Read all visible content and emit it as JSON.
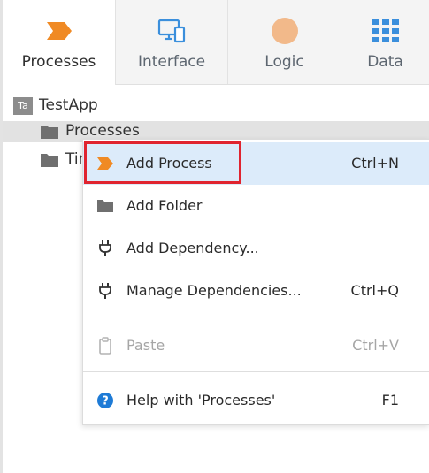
{
  "tabs": [
    {
      "label": "Processes",
      "icon": "process-icon"
    },
    {
      "label": "Interface",
      "icon": "interface-icon"
    },
    {
      "label": "Logic",
      "icon": "logic-icon"
    },
    {
      "label": "Data",
      "icon": "data-grid-icon"
    }
  ],
  "tree": {
    "app_badge": "Ta",
    "app_name": "TestApp",
    "items": [
      {
        "label": "Processes"
      },
      {
        "label": "Tim"
      }
    ]
  },
  "menu": {
    "items": [
      {
        "label": "Add Process",
        "shortcut": "Ctrl+N",
        "icon": "process-icon"
      },
      {
        "label": "Add Folder",
        "shortcut": "",
        "icon": "folder-icon"
      },
      {
        "label": "Add Dependency...",
        "shortcut": "",
        "icon": "plug-icon"
      },
      {
        "label": "Manage Dependencies...",
        "shortcut": "Ctrl+Q",
        "icon": "plug-icon"
      },
      {
        "label": "Paste",
        "shortcut": "Ctrl+V",
        "icon": "clipboard-icon",
        "disabled": true
      },
      {
        "label": "Help with 'Processes'",
        "shortcut": "F1",
        "icon": "help-icon"
      }
    ]
  },
  "colors": {
    "accent_orange": "#f08a24",
    "highlight": "#dcebfa",
    "red_outline": "#e0242f",
    "icon_blue": "#3b8fdc",
    "logic_peach": "#f2b98a"
  }
}
